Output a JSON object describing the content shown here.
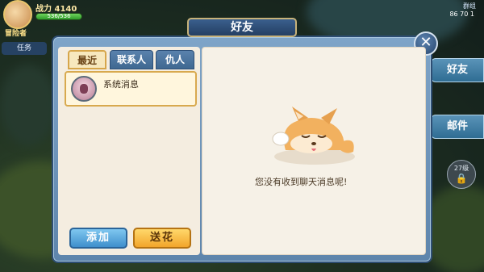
{
  "hud": {
    "power_label": "战力 4140",
    "hp_text": "536/536",
    "level_text": "冒险者",
    "task_label": "任务",
    "right_label": "群组",
    "right_value": "86 70 1",
    "side_tab_friends": "好友",
    "side_tab_mail": "邮件",
    "lock_level": "27级"
  },
  "panel": {
    "title": "好友",
    "close_symbol": "✕",
    "tabs": [
      {
        "label": "最近",
        "active": true
      },
      {
        "label": "联系人",
        "active": false
      },
      {
        "label": "仇人",
        "active": false
      }
    ],
    "messages": [
      {
        "name": "系统消息",
        "icon": "system-avatar-icon"
      }
    ],
    "add_button": "添加",
    "flower_button": "送花",
    "empty_message": "您没有收到聊天消息呢!"
  },
  "colors": {
    "panel_blue": "#5e85ac",
    "tab_active_border": "#d6a64b",
    "add_blue": "#3f8fcc",
    "flower_gold": "#f2a52b"
  }
}
